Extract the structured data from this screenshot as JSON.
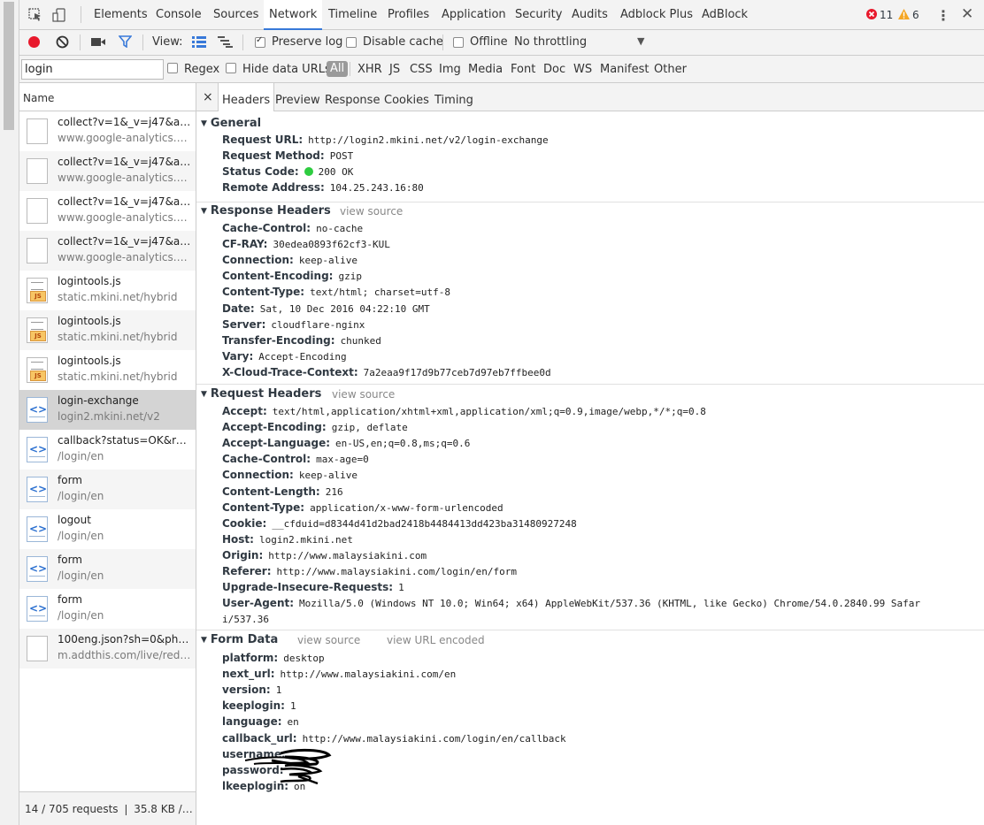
{
  "devtools_tabs": [
    "Elements",
    "Console",
    "Sources",
    "Network",
    "Timeline",
    "Profiles",
    "Application",
    "Security",
    "Audits",
    "Adblock Plus",
    "AdBlock"
  ],
  "active_tab": "Network",
  "badges": {
    "errors": "11",
    "warnings": "6"
  },
  "toolbar": {
    "view_label": "View:",
    "preserve_log": "Preserve log",
    "disable_cache": "Disable cache",
    "offline": "Offline",
    "throttling": "No throttling"
  },
  "filter": {
    "value": "login",
    "regex": "Regex",
    "hide_data_urls": "Hide data URLs",
    "types": [
      "All",
      "XHR",
      "JS",
      "CSS",
      "Img",
      "Media",
      "Font",
      "Doc",
      "WS",
      "Manifest",
      "Other"
    ]
  },
  "list": {
    "header": "Name",
    "rows": [
      {
        "name": "collect?v=1&_v=j47&a=11...",
        "path": "www.google-analytics.com",
        "type": "blank"
      },
      {
        "name": "collect?v=1&_v=j47&a=11...",
        "path": "www.google-analytics.com",
        "type": "blank"
      },
      {
        "name": "collect?v=1&_v=j47&a=19...",
        "path": "www.google-analytics.com",
        "type": "blank"
      },
      {
        "name": "collect?v=1&_v=j47&a=19...",
        "path": "www.google-analytics.com",
        "type": "blank"
      },
      {
        "name": "logintools.js",
        "path": "static.mkini.net/hybrid",
        "type": "js"
      },
      {
        "name": "logintools.js",
        "path": "static.mkini.net/hybrid",
        "type": "js"
      },
      {
        "name": "logintools.js",
        "path": "static.mkini.net/hybrid",
        "type": "js"
      },
      {
        "name": "login-exchange",
        "path": "login2.mkini.net/v2",
        "type": "doc"
      },
      {
        "name": "callback?status=OK&regist...",
        "path": "/login/en",
        "type": "doc"
      },
      {
        "name": "form",
        "path": "/login/en",
        "type": "doc"
      },
      {
        "name": "logout",
        "path": "/login/en",
        "type": "doc"
      },
      {
        "name": "form",
        "path": "/login/en",
        "type": "doc"
      },
      {
        "name": "form",
        "path": "/login/en",
        "type": "doc"
      },
      {
        "name": "100eng.json?sh=0&ph=68...",
        "path": "m.addthis.com/live/red_loj...",
        "type": "blank"
      }
    ],
    "summary": "14 / 705 requests ❘ 35.8 KB / 3...."
  },
  "detail_tabs": [
    "Headers",
    "Preview",
    "Response",
    "Cookies",
    "Timing"
  ],
  "view_source": "view source",
  "view_url_encoded": "view URL encoded",
  "general": {
    "title": "General",
    "items": [
      {
        "k": "Request URL:",
        "v": "http://login2.mkini.net/v2/login-exchange"
      },
      {
        "k": "Request Method:",
        "v": "POST"
      },
      {
        "k": "Status Code:",
        "v": "200 OK"
      },
      {
        "k": "Remote Address:",
        "v": "104.25.243.16:80"
      }
    ]
  },
  "response_headers": {
    "title": "Response Headers",
    "items": [
      {
        "k": "Cache-Control:",
        "v": "no-cache"
      },
      {
        "k": "CF-RAY:",
        "v": "30edea0893f62cf3-KUL"
      },
      {
        "k": "Connection:",
        "v": "keep-alive"
      },
      {
        "k": "Content-Encoding:",
        "v": "gzip"
      },
      {
        "k": "Content-Type:",
        "v": "text/html; charset=utf-8"
      },
      {
        "k": "Date:",
        "v": "Sat, 10 Dec 2016 04:22:10 GMT"
      },
      {
        "k": "Server:",
        "v": "cloudflare-nginx"
      },
      {
        "k": "Transfer-Encoding:",
        "v": "chunked"
      },
      {
        "k": "Vary:",
        "v": "Accept-Encoding"
      },
      {
        "k": "X-Cloud-Trace-Context:",
        "v": "7a2eaa9f17d9b77ceb7d97eb7ffbee0d"
      }
    ]
  },
  "request_headers": {
    "title": "Request Headers",
    "items": [
      {
        "k": "Accept:",
        "v": "text/html,application/xhtml+xml,application/xml;q=0.9,image/webp,*/*;q=0.8"
      },
      {
        "k": "Accept-Encoding:",
        "v": "gzip, deflate"
      },
      {
        "k": "Accept-Language:",
        "v": "en-US,en;q=0.8,ms;q=0.6"
      },
      {
        "k": "Cache-Control:",
        "v": "max-age=0"
      },
      {
        "k": "Connection:",
        "v": "keep-alive"
      },
      {
        "k": "Content-Length:",
        "v": "216"
      },
      {
        "k": "Content-Type:",
        "v": "application/x-www-form-urlencoded"
      },
      {
        "k": "Cookie:",
        "v": "__cfduid=d8344d41d2bad2418b4484413dd423ba31480927248"
      },
      {
        "k": "Host:",
        "v": "login2.mkini.net"
      },
      {
        "k": "Origin:",
        "v": "http://www.malaysiakini.com"
      },
      {
        "k": "Referer:",
        "v": "http://www.malaysiakini.com/login/en/form"
      },
      {
        "k": "Upgrade-Insecure-Requests:",
        "v": "1"
      },
      {
        "k": "User-Agent:",
        "v": "Mozilla/5.0 (Windows NT 10.0; Win64; x64) AppleWebKit/537.36 (KHTML, like Gecko) Chrome/54.0.2840.99 Safar"
      }
    ],
    "user_agent_wrap": "i/537.36"
  },
  "form_data": {
    "title": "Form Data",
    "items": [
      {
        "k": "platform:",
        "v": "desktop"
      },
      {
        "k": "next_url:",
        "v": "http://www.malaysiakini.com/en"
      },
      {
        "k": "version:",
        "v": "1"
      },
      {
        "k": "keeplogin:",
        "v": "1"
      },
      {
        "k": "language:",
        "v": "en"
      },
      {
        "k": "callback_url:",
        "v": "http://www.malaysiakini.com/login/en/callback"
      },
      {
        "k": "username:",
        "v": ""
      },
      {
        "k": "password:",
        "v": ""
      },
      {
        "k": "lkeeplogin:",
        "v": "on"
      }
    ]
  },
  "colors": {
    "accent": "#3879d9",
    "record": "#e8192c",
    "status_ok": "#2ecc40",
    "error": "#e8192c",
    "warning": "#f5a623"
  }
}
